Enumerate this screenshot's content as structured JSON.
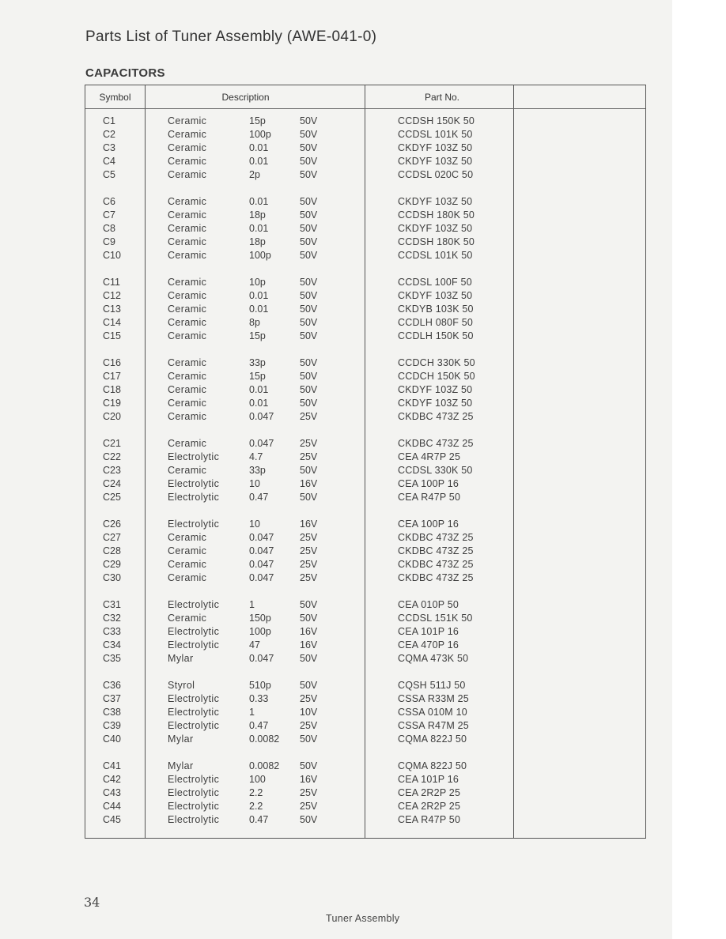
{
  "document": {
    "title": "Parts List of Tuner Assembly (AWE-041-0)",
    "section": "CAPACITORS",
    "page_number": "34",
    "footer": "Tuner Assembly"
  },
  "table": {
    "headers": [
      "Symbol",
      "Description",
      "Part No.",
      ""
    ],
    "groups": [
      [
        {
          "symbol": "C1",
          "type": "Ceramic",
          "value": "15p",
          "voltage": "50V",
          "part_no": "CCDSH 150K 50"
        },
        {
          "symbol": "C2",
          "type": "Ceramic",
          "value": "100p",
          "voltage": "50V",
          "part_no": "CCDSL 101K 50"
        },
        {
          "symbol": "C3",
          "type": "Ceramic",
          "value": "0.01",
          "voltage": "50V",
          "part_no": "CKDYF 103Z 50"
        },
        {
          "symbol": "C4",
          "type": "Ceramic",
          "value": "0.01",
          "voltage": "50V",
          "part_no": "CKDYF 103Z 50"
        },
        {
          "symbol": "C5",
          "type": "Ceramic",
          "value": "2p",
          "voltage": "50V",
          "part_no": "CCDSL 020C 50"
        }
      ],
      [
        {
          "symbol": "C6",
          "type": "Ceramic",
          "value": "0.01",
          "voltage": "50V",
          "part_no": "CKDYF 103Z 50"
        },
        {
          "symbol": "C7",
          "type": "Ceramic",
          "value": "18p",
          "voltage": "50V",
          "part_no": "CCDSH 180K 50"
        },
        {
          "symbol": "C8",
          "type": "Ceramic",
          "value": "0.01",
          "voltage": "50V",
          "part_no": "CKDYF 103Z 50"
        },
        {
          "symbol": "C9",
          "type": "Ceramic",
          "value": "18p",
          "voltage": "50V",
          "part_no": "CCDSH 180K 50"
        },
        {
          "symbol": "C10",
          "type": "Ceramic",
          "value": "100p",
          "voltage": "50V",
          "part_no": "CCDSL 101K 50"
        }
      ],
      [
        {
          "symbol": "C11",
          "type": "Ceramic",
          "value": "10p",
          "voltage": "50V",
          "part_no": "CCDSL 100F 50"
        },
        {
          "symbol": "C12",
          "type": "Ceramic",
          "value": "0.01",
          "voltage": "50V",
          "part_no": "CKDYF 103Z 50"
        },
        {
          "symbol": "C13",
          "type": "Ceramic",
          "value": "0.01",
          "voltage": "50V",
          "part_no": "CKDYB 103K 50"
        },
        {
          "symbol": "C14",
          "type": "Ceramic",
          "value": "8p",
          "voltage": "50V",
          "part_no": "CCDLH 080F 50"
        },
        {
          "symbol": "C15",
          "type": "Ceramic",
          "value": "15p",
          "voltage": "50V",
          "part_no": "CCDLH 150K 50"
        }
      ],
      [
        {
          "symbol": "C16",
          "type": "Ceramic",
          "value": "33p",
          "voltage": "50V",
          "part_no": "CCDCH 330K 50"
        },
        {
          "symbol": "C17",
          "type": "Ceramic",
          "value": "15p",
          "voltage": "50V",
          "part_no": "CCDCH 150K 50"
        },
        {
          "symbol": "C18",
          "type": "Ceramic",
          "value": "0.01",
          "voltage": "50V",
          "part_no": "CKDYF 103Z 50"
        },
        {
          "symbol": "C19",
          "type": "Ceramic",
          "value": "0.01",
          "voltage": "50V",
          "part_no": "CKDYF 103Z 50"
        },
        {
          "symbol": "C20",
          "type": "Ceramic",
          "value": "0.047",
          "voltage": "25V",
          "part_no": "CKDBC 473Z 25"
        }
      ],
      [
        {
          "symbol": "C21",
          "type": "Ceramic",
          "value": "0.047",
          "voltage": "25V",
          "part_no": "CKDBC 473Z 25"
        },
        {
          "symbol": "C22",
          "type": "Electrolytic",
          "value": "4.7",
          "voltage": "25V",
          "part_no": "CEA 4R7P 25"
        },
        {
          "symbol": "C23",
          "type": "Ceramic",
          "value": "33p",
          "voltage": "50V",
          "part_no": "CCDSL 330K 50"
        },
        {
          "symbol": "C24",
          "type": "Electrolytic",
          "value": "10",
          "voltage": "16V",
          "part_no": "CEA 100P 16"
        },
        {
          "symbol": "C25",
          "type": "Electrolytic",
          "value": "0.47",
          "voltage": "50V",
          "part_no": "CEA R47P 50"
        }
      ],
      [
        {
          "symbol": "C26",
          "type": "Electrolytic",
          "value": "10",
          "voltage": "16V",
          "part_no": "CEA 100P 16"
        },
        {
          "symbol": "C27",
          "type": "Ceramic",
          "value": "0.047",
          "voltage": "25V",
          "part_no": "CKDBC 473Z 25"
        },
        {
          "symbol": "C28",
          "type": "Ceramic",
          "value": "0.047",
          "voltage": "25V",
          "part_no": "CKDBC 473Z 25"
        },
        {
          "symbol": "C29",
          "type": "Ceramic",
          "value": "0.047",
          "voltage": "25V",
          "part_no": "CKDBC 473Z 25"
        },
        {
          "symbol": "C30",
          "type": "Ceramic",
          "value": "0.047",
          "voltage": "25V",
          "part_no": "CKDBC 473Z 25"
        }
      ],
      [
        {
          "symbol": "C31",
          "type": "Electrolytic",
          "value": "1",
          "voltage": "50V",
          "part_no": "CEA 010P 50"
        },
        {
          "symbol": "C32",
          "type": "Ceramic",
          "value": "150p",
          "voltage": "50V",
          "part_no": "CCDSL 151K 50"
        },
        {
          "symbol": "C33",
          "type": "Electrolytic",
          "value": "100p",
          "voltage": "16V",
          "part_no": "CEA 101P 16"
        },
        {
          "symbol": "C34",
          "type": "Electrolytic",
          "value": "47",
          "voltage": "16V",
          "part_no": "CEA 470P 16"
        },
        {
          "symbol": "C35",
          "type": "Mylar",
          "value": "0.047",
          "voltage": "50V",
          "part_no": "CQMA 473K 50"
        }
      ],
      [
        {
          "symbol": "C36",
          "type": "Styrol",
          "value": "510p",
          "voltage": "50V",
          "part_no": "CQSH 511J 50"
        },
        {
          "symbol": "C37",
          "type": "Electrolytic",
          "value": "0.33",
          "voltage": "25V",
          "part_no": "CSSA R33M 25"
        },
        {
          "symbol": "C38",
          "type": "Electrolytic",
          "value": "1",
          "voltage": "10V",
          "part_no": "CSSA 010M 10"
        },
        {
          "symbol": "C39",
          "type": "Electrolytic",
          "value": "0.47",
          "voltage": "25V",
          "part_no": "CSSA R47M 25"
        },
        {
          "symbol": "C40",
          "type": "Mylar",
          "value": "0.0082",
          "voltage": "50V",
          "part_no": "CQMA 822J 50"
        }
      ],
      [
        {
          "symbol": "C41",
          "type": "Mylar",
          "value": "0.0082",
          "voltage": "50V",
          "part_no": "CQMA 822J 50"
        },
        {
          "symbol": "C42",
          "type": "Electrolytic",
          "value": "100",
          "voltage": "16V",
          "part_no": "CEA 101P 16"
        },
        {
          "symbol": "C43",
          "type": "Electrolytic",
          "value": "2.2",
          "voltage": "25V",
          "part_no": "CEA 2R2P 25"
        },
        {
          "symbol": "C44",
          "type": "Electrolytic",
          "value": "2.2",
          "voltage": "25V",
          "part_no": "CEA 2R2P 25"
        },
        {
          "symbol": "C45",
          "type": "Electrolytic",
          "value": "0.47",
          "voltage": "50V",
          "part_no": "CEA R47P 50"
        }
      ]
    ]
  }
}
